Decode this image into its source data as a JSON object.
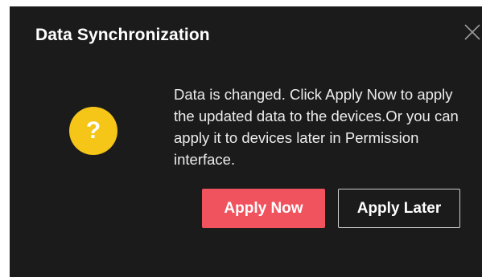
{
  "dialog": {
    "title": "Data Synchronization",
    "icon": "question-icon",
    "icon_glyph": "?",
    "message": "Data is changed. Click Apply Now to apply the updated data to the devices.Or you can apply it to devices later in Permission interface.",
    "close_icon": "close-icon",
    "buttons": {
      "apply_now": "Apply Now",
      "apply_later": "Apply Later"
    }
  },
  "colors": {
    "dialog_background": "#1b1b1b",
    "primary_button": "#f0525e",
    "question_icon": "#f5c518"
  }
}
